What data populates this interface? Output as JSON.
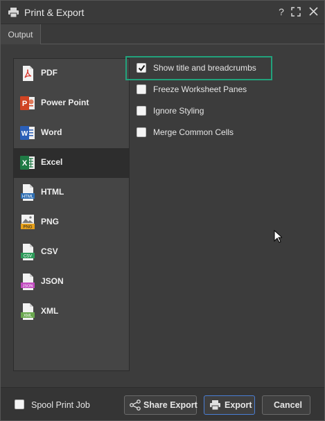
{
  "window": {
    "title": "Print & Export",
    "help_label": "?"
  },
  "tabs": [
    {
      "label": "Output"
    }
  ],
  "formats": [
    {
      "label": "PDF",
      "icon": "pdf-icon",
      "color": "#d9352b"
    },
    {
      "label": "Power Point",
      "icon": "powerpoint-icon",
      "color": "#d04423"
    },
    {
      "label": "Word",
      "icon": "word-icon",
      "color": "#2b5fb8"
    },
    {
      "label": "Excel",
      "icon": "excel-icon",
      "color": "#1f7a45",
      "selected": true
    },
    {
      "label": "HTML",
      "icon": "html-icon",
      "color": "#2f6fb3",
      "badge": "HTML"
    },
    {
      "label": "PNG",
      "icon": "png-icon",
      "color": "#e6a01c",
      "badge": "PNG"
    },
    {
      "label": "CSV",
      "icon": "csv-icon",
      "color": "#2e9b5a",
      "badge": "CSV"
    },
    {
      "label": "JSON",
      "icon": "json-icon",
      "color": "#c24cc0",
      "badge": "JSON"
    },
    {
      "label": "XML",
      "icon": "xml-icon",
      "color": "#6aa84f",
      "badge": "XML"
    }
  ],
  "options": [
    {
      "label": "Show title and breadcrumbs",
      "checked": true
    },
    {
      "label": "Freeze Worksheet Panes",
      "checked": false
    },
    {
      "label": "Ignore Styling",
      "checked": false
    },
    {
      "label": "Merge Common Cells",
      "checked": false
    }
  ],
  "footer": {
    "spool_label": "Spool Print Job",
    "spool_checked": false,
    "share_label": "Share Export",
    "export_label": "Export",
    "cancel_label": "Cancel"
  },
  "colors": {
    "highlight": "#22a27c",
    "primary_border": "#4a7fd6"
  }
}
